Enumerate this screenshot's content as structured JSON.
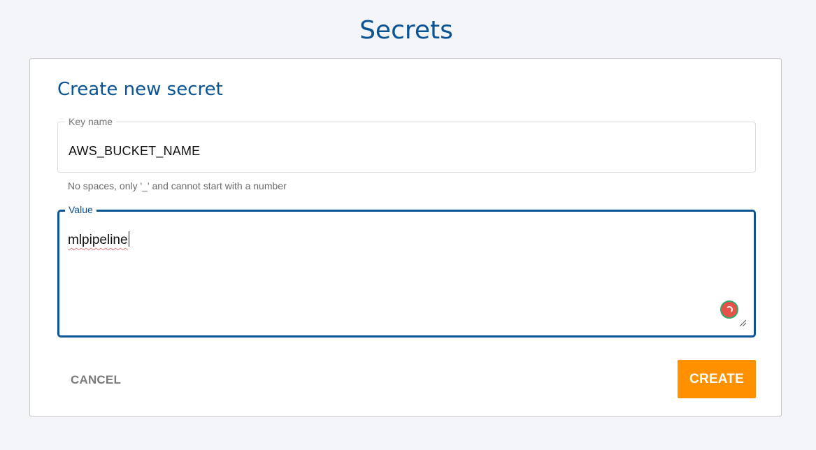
{
  "page": {
    "title": "Secrets"
  },
  "form": {
    "title": "Create new secret",
    "key_field": {
      "label": "Key name",
      "value": "AWS_BUCKET_NAME",
      "helper": "No spaces, only '_' and cannot start with a number"
    },
    "value_field": {
      "label": "Value",
      "value": "mlpipeline"
    },
    "cancel_label": "CANCEL",
    "create_label": "CREATE"
  },
  "colors": {
    "background": "#f4f5f9",
    "primary": "#0b5394",
    "accent": "#ff9100",
    "grammar_badge": "#e4524a"
  },
  "icons": {
    "grammar_badge": "grammar-check-icon",
    "resize_handle": "resize-handle-icon"
  }
}
